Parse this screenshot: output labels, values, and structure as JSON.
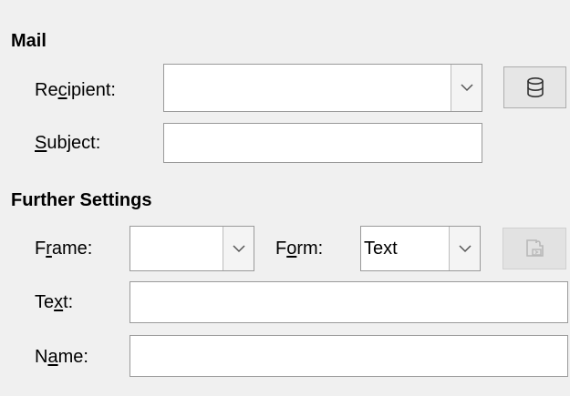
{
  "mail": {
    "title": "Mail",
    "recipient": {
      "pre": "Re",
      "u": "c",
      "post": "ipient:",
      "value": ""
    },
    "subject": {
      "pre": "",
      "u": "S",
      "post": "ubject:",
      "value": ""
    },
    "database_button_icon": "database-icon"
  },
  "further": {
    "title": "Further Settings",
    "frame": {
      "pre": "F",
      "u": "r",
      "post": "ame:",
      "value": ""
    },
    "form": {
      "pre": "F",
      "u": "o",
      "post": "rm:",
      "value": "Text"
    },
    "text": {
      "pre": "Te",
      "u": "x",
      "post": "t:",
      "value": ""
    },
    "name": {
      "pre": "N",
      "u": "a",
      "post": "me:",
      "value": ""
    },
    "extension_button_icon": "extension-icon",
    "extension_button_disabled": true
  },
  "colors": {
    "background": "#f0f0f0",
    "field_border": "#9a9a9a",
    "disabled_icon": "#b8b8b8"
  }
}
